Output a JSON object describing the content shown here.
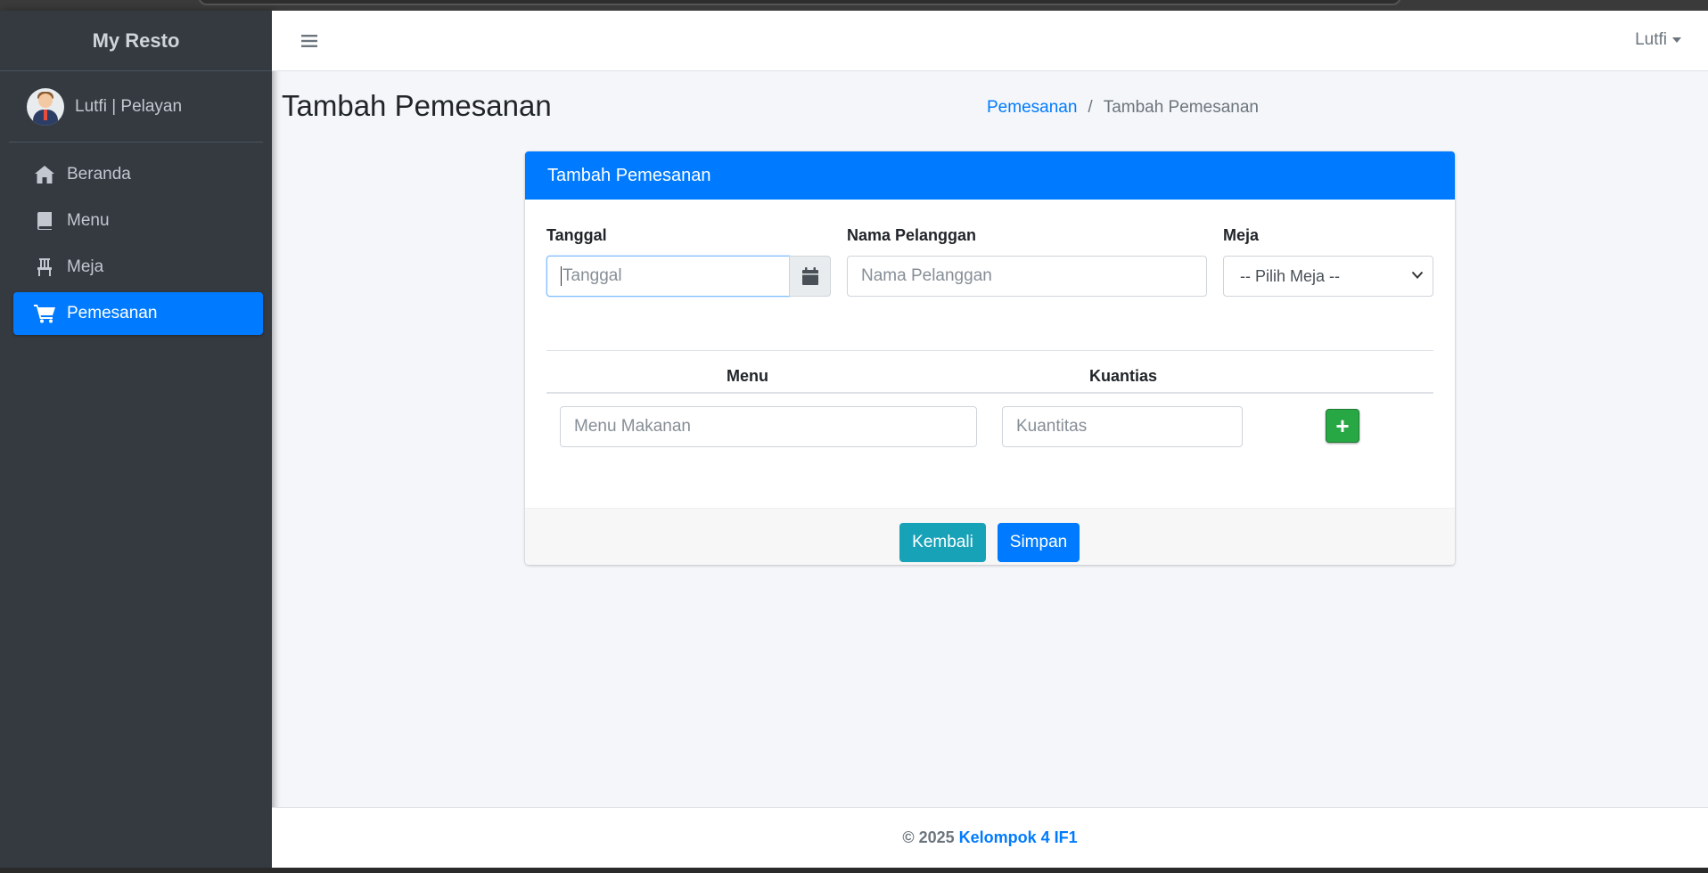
{
  "app": {
    "brand": "My Resto"
  },
  "user_panel": {
    "name": "Lutfi | Pelayan"
  },
  "sidebar": {
    "items": [
      {
        "label": "Beranda",
        "icon": "home-icon",
        "active": false
      },
      {
        "label": "Menu",
        "icon": "book-icon",
        "active": false
      },
      {
        "label": "Meja",
        "icon": "chair-icon",
        "active": false
      },
      {
        "label": "Pemesanan",
        "icon": "cart-icon",
        "active": true
      }
    ]
  },
  "header": {
    "user": "Lutfi"
  },
  "page": {
    "title": "Tambah Pemesanan",
    "breadcrumb": {
      "parent": "Pemesanan",
      "separator": "/",
      "current": "Tambah Pemesanan"
    }
  },
  "card": {
    "title": "Tambah Pemesanan",
    "fields": {
      "tanggal": {
        "label": "Tanggal",
        "placeholder": "Tanggal"
      },
      "nama": {
        "label": "Nama Pelanggan",
        "placeholder": "Nama Pelanggan"
      },
      "meja": {
        "label": "Meja",
        "selected": "-- Pilih Meja --"
      }
    },
    "table": {
      "headers": {
        "menu": "Menu",
        "qty": "Kuantias"
      },
      "row": {
        "menu_placeholder": "Menu Makanan",
        "qty_placeholder": "Kuantitas",
        "add": "+"
      }
    },
    "buttons": {
      "back": "Kembali",
      "save": "Simpan"
    }
  },
  "footer": {
    "copyright": "© 2025",
    "link": "Kelompok 4 IF1"
  },
  "colors": {
    "primary": "#007bff",
    "sidebar": "#343a40",
    "info": "#17a2b8",
    "success": "#28a745"
  }
}
